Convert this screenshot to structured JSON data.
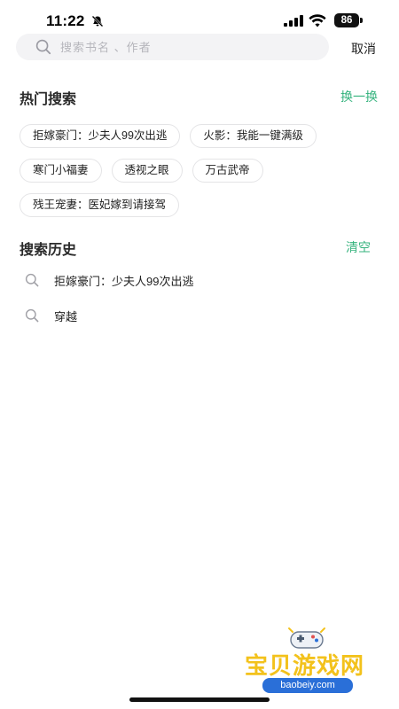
{
  "status_bar": {
    "time": "11:22",
    "battery": "86",
    "icons": [
      "bell-slash-icon",
      "signal-icon",
      "wifi-icon",
      "battery-icon"
    ]
  },
  "search": {
    "placeholder": "搜索书名 、作者",
    "value": "",
    "cancel_label": "取消"
  },
  "hot": {
    "title": "热门搜索",
    "action": "换一换",
    "rows": [
      [
        "拒嫁豪门：少夫人99次出逃",
        "火影：我能一键满级"
      ],
      [
        "寒门小福妻",
        "透视之眼",
        "万古武帝"
      ],
      [
        "残王宠妻：医妃嫁到请接驾"
      ]
    ]
  },
  "history": {
    "title": "搜索历史",
    "action": "清空",
    "items": [
      "拒嫁豪门：少夫人99次出逃",
      "穿越"
    ]
  },
  "watermark": {
    "text": "宝贝游戏网",
    "url": "baobeiy.com"
  },
  "colors": {
    "accent": "#36b37e",
    "search_bg": "#f3f3f5",
    "chip_border": "#e4e4e6"
  }
}
